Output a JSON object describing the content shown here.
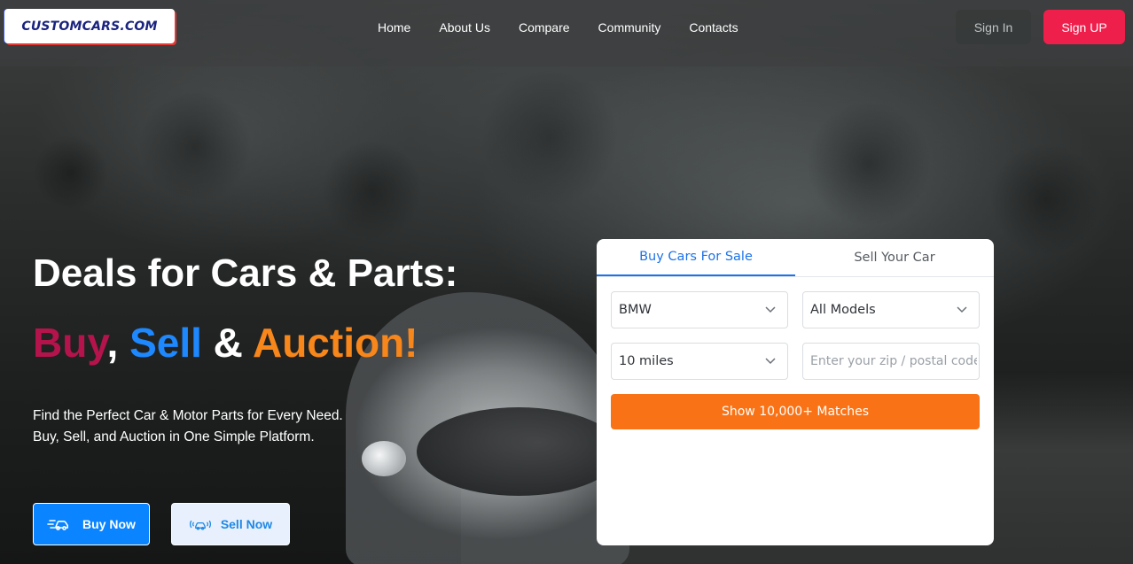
{
  "brand": {
    "logo_text": "CUSTOMCARS.COM"
  },
  "nav": {
    "items": [
      {
        "label": "Home"
      },
      {
        "label": "About Us"
      },
      {
        "label": "Compare"
      },
      {
        "label": "Community"
      },
      {
        "label": "Contacts"
      }
    ]
  },
  "auth": {
    "sign_in": "Sign In",
    "sign_up": "Sign UP"
  },
  "hero": {
    "headline": "Deals for Cars & Parts:",
    "subline": {
      "buy": "Buy",
      "comma": ", ",
      "sell": "Sell",
      "amp": " & ",
      "auction": "Auction!"
    },
    "description_line1": "Find the Perfect Car & Motor Parts for Every Need.",
    "description_line2": "Buy, Sell, and Auction in One Simple Platform.",
    "buy_button": "Buy Now",
    "sell_button": "Sell Now"
  },
  "search": {
    "tabs": [
      {
        "label": "Buy Cars For Sale",
        "active": true
      },
      {
        "label": "Sell Your Car",
        "active": false
      }
    ],
    "make": {
      "value": "BMW"
    },
    "model": {
      "value": "All Models"
    },
    "distance": {
      "value": "10 miles"
    },
    "zip": {
      "value": "",
      "placeholder": "Enter your zip / postal code"
    },
    "submit_label": "Show 10,000+ Matches"
  },
  "colors": {
    "buy": "#b5134b",
    "sell": "#1e88ff",
    "auction": "#f7861b",
    "signup_bg": "#ef1f4c",
    "primary_blue": "#0a84ff",
    "orange_cta": "#f97316"
  },
  "icons": {
    "buy_button_icon": "car-speed-icon",
    "sell_button_icon": "car-signal-icon",
    "select_arrow": "chevron-down-icon"
  }
}
